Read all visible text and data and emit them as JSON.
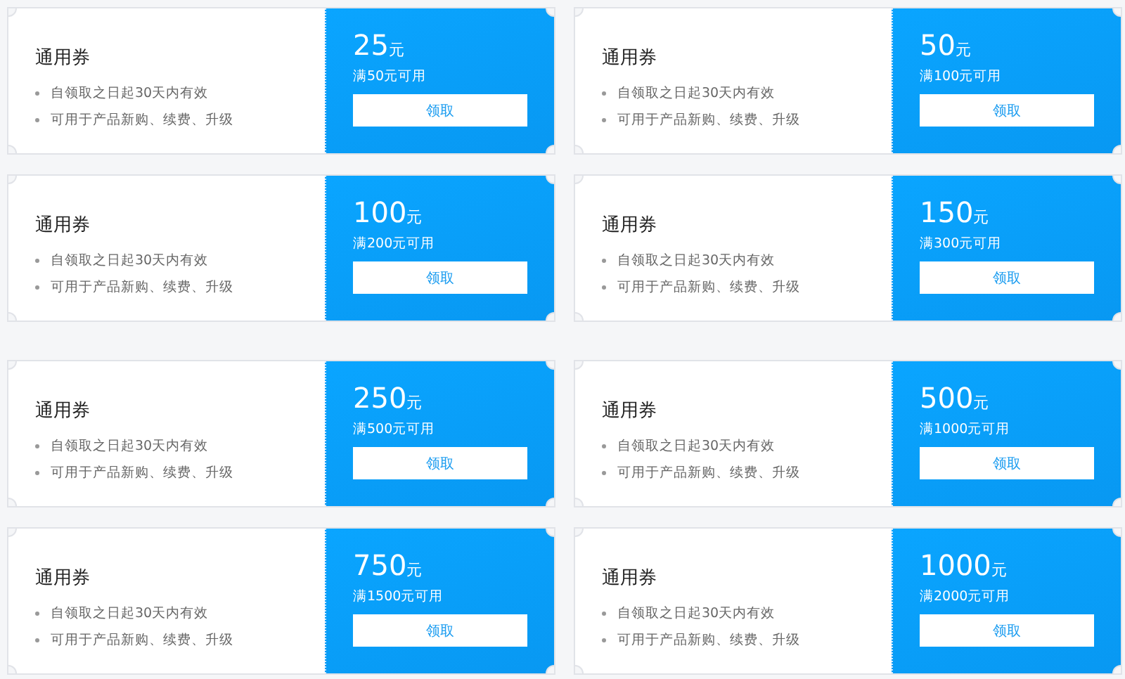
{
  "sections": [
    {
      "coupons": [
        {
          "title": "通用券",
          "bullets": [
            "自领取之日起30天内有效",
            "可用于产品新购、续费、升级"
          ],
          "amount": "25",
          "unit": "元",
          "condition": "满50元可用",
          "button": "领取"
        },
        {
          "title": "通用券",
          "bullets": [
            "自领取之日起30天内有效",
            "可用于产品新购、续费、升级"
          ],
          "amount": "50",
          "unit": "元",
          "condition": "满100元可用",
          "button": "领取"
        },
        {
          "title": "通用券",
          "bullets": [
            "自领取之日起30天内有效",
            "可用于产品新购、续费、升级"
          ],
          "amount": "100",
          "unit": "元",
          "condition": "满200元可用",
          "button": "领取"
        },
        {
          "title": "通用券",
          "bullets": [
            "自领取之日起30天内有效",
            "可用于产品新购、续费、升级"
          ],
          "amount": "150",
          "unit": "元",
          "condition": "满300元可用",
          "button": "领取"
        }
      ]
    },
    {
      "coupons": [
        {
          "title": "通用券",
          "bullets": [
            "自领取之日起30天内有效",
            "可用于产品新购、续费、升级"
          ],
          "amount": "250",
          "unit": "元",
          "condition": "满500元可用",
          "button": "领取"
        },
        {
          "title": "通用券",
          "bullets": [
            "自领取之日起30天内有效",
            "可用于产品新购、续费、升级"
          ],
          "amount": "500",
          "unit": "元",
          "condition": "满1000元可用",
          "button": "领取"
        },
        {
          "title": "通用券",
          "bullets": [
            "自领取之日起30天内有效",
            "可用于产品新购、续费、升级"
          ],
          "amount": "750",
          "unit": "元",
          "condition": "满1500元可用",
          "button": "领取"
        },
        {
          "title": "通用券",
          "bullets": [
            "自领取之日起30天内有效",
            "可用于产品新购、续费、升级"
          ],
          "amount": "1000",
          "unit": "元",
          "condition": "满2000元可用",
          "button": "领取"
        }
      ]
    }
  ]
}
